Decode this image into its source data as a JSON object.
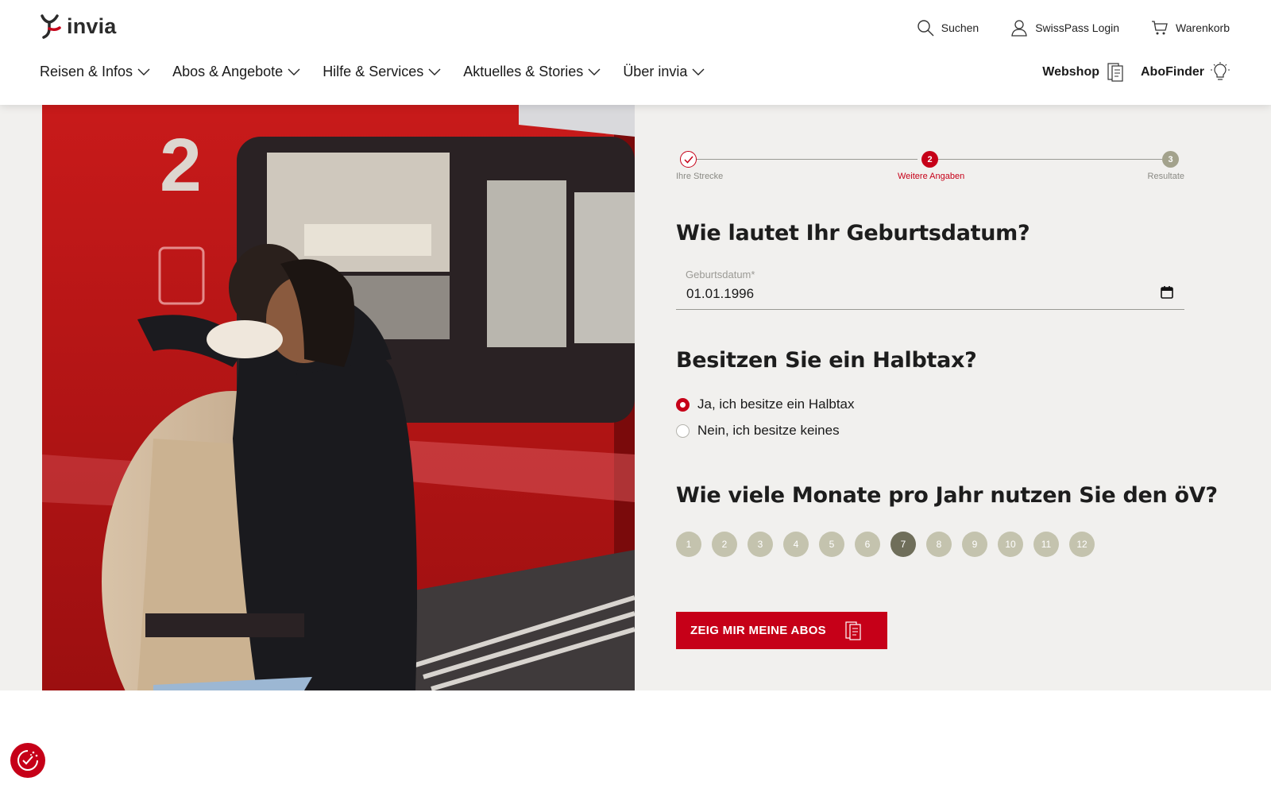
{
  "brand": {
    "name": "invia",
    "accent": "#c60018"
  },
  "utility": {
    "search": "Suchen",
    "login": "SwissPass Login",
    "cart": "Warenkorb"
  },
  "nav": {
    "items": [
      {
        "label": "Reisen & Infos"
      },
      {
        "label": "Abos & Angebote"
      },
      {
        "label": "Hilfe & Services"
      },
      {
        "label": "Aktuelles & Stories"
      },
      {
        "label": "Über invia"
      }
    ],
    "webshop": "Webshop",
    "abofinder": "AboFinder"
  },
  "stepper": {
    "steps": [
      {
        "label": "Ihre Strecke",
        "marker": "",
        "state": "done"
      },
      {
        "label": "Weitere Angaben",
        "marker": "2",
        "state": "active"
      },
      {
        "label": "Resultate",
        "marker": "3",
        "state": "upcoming"
      }
    ]
  },
  "birthdate": {
    "question": "Wie lautet Ihr Geburtsdatum?",
    "label": "Geburtsdatum*",
    "value": "01.01.1996"
  },
  "halbtax": {
    "question": "Besitzen Sie ein Halbtax?",
    "options": [
      {
        "label": "Ja, ich besitze ein Halbtax",
        "selected": true
      },
      {
        "label": "Nein, ich besitze keines",
        "selected": false
      }
    ]
  },
  "months": {
    "question": "Wie viele Monate pro Jahr nutzen Sie den öV?",
    "options": [
      "1",
      "2",
      "3",
      "4",
      "5",
      "6",
      "7",
      "8",
      "9",
      "10",
      "11",
      "12"
    ],
    "selected": "7"
  },
  "cta": {
    "label": "ZEIG MIR MEINE ABOS"
  }
}
